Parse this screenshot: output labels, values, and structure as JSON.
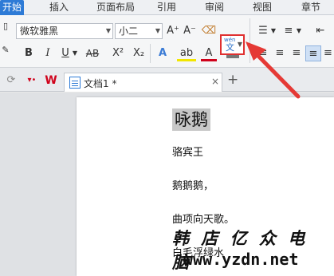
{
  "tabs": [
    "开始",
    "插入",
    "页面布局",
    "引用",
    "审阅",
    "视图",
    "章节"
  ],
  "ribbon": {
    "font_name": "微软雅黑",
    "font_size": "小二",
    "grow_font": "A⁺",
    "shrink_font": "A⁻",
    "bold": "B",
    "italic": "I",
    "underline": "U",
    "strike": "AB",
    "superscript": "X²",
    "subscript": "X₂",
    "text_effect": "A",
    "highlight": "ab",
    "font_color": "A",
    "char_shade": "A",
    "pinyin_top": "wén",
    "pinyin_bottom": "文"
  },
  "doc_tab": {
    "title": "文档1 *",
    "close": "×",
    "new_tab": "+"
  },
  "document": {
    "title": "咏鹅",
    "lines": [
      "骆宾王",
      "鹅鹅鹅，",
      "曲项向天歌。",
      "白毛浮绿水"
    ]
  },
  "watermark": {
    "text": "韩 店 亿 众 电 脑",
    "url": "www.yzdn.net"
  },
  "colors": {
    "accent": "#2e7bd6",
    "highlight_red": "#e03030"
  }
}
